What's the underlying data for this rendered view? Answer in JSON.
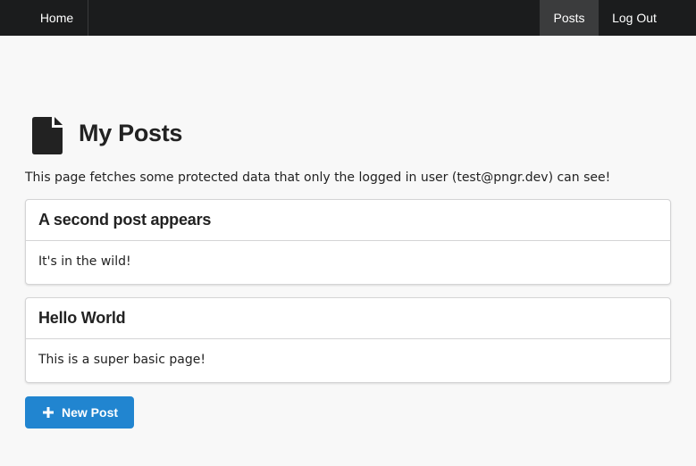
{
  "nav": {
    "home_label": "Home",
    "posts_label": "Posts",
    "logout_label": "Log Out"
  },
  "page": {
    "icon": "file-icon",
    "title": "My Posts",
    "intro": "This page fetches some protected data that only the logged in user (test@pngr.dev) can see!"
  },
  "posts": [
    {
      "title": "A second post appears",
      "body": "It's in the wild!"
    },
    {
      "title": "Hello World",
      "body": "This is a super basic page!"
    }
  ],
  "new_post_button": {
    "icon": "plus-icon",
    "label": "New Post"
  },
  "colors": {
    "navbar": "#1b1c1d",
    "active_nav": "#3b3c3d",
    "primary_button": "#2185d0",
    "page_background": "#f8f8f8"
  }
}
